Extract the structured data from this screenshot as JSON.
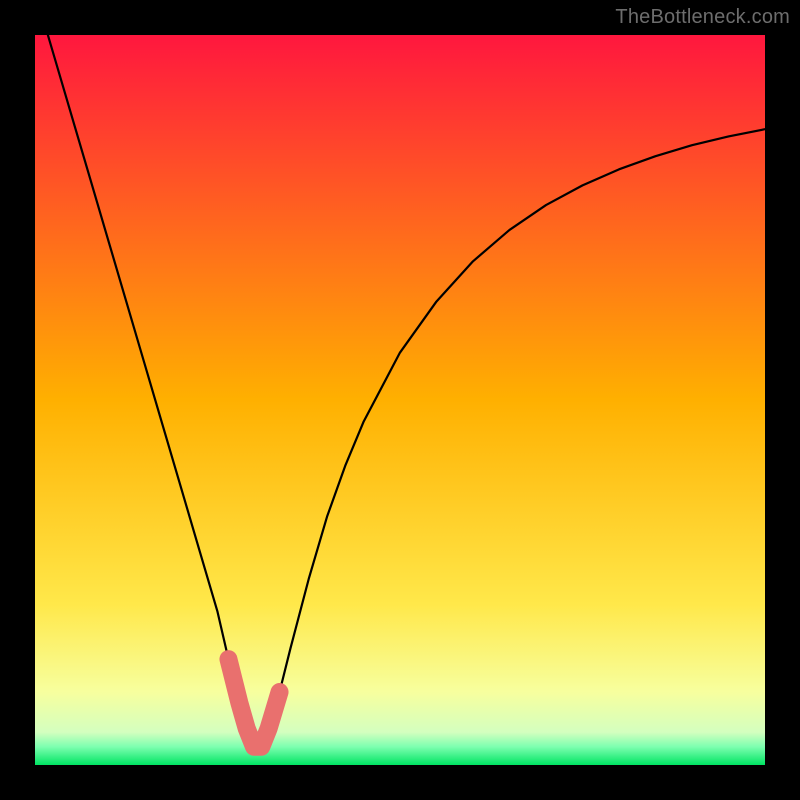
{
  "watermark": "TheBottleneck.com",
  "colors": {
    "frame": "#000000",
    "gradient_top": "#ff173e",
    "gradient_mid": "#ffd400",
    "gradient_green": "#00e463",
    "curve": "#000000",
    "highlight": "#e9706e"
  },
  "chart_data": {
    "type": "line",
    "title": "",
    "xlabel": "",
    "ylabel": "",
    "xlim": [
      0,
      100
    ],
    "ylim": [
      0,
      100
    ],
    "grid": false,
    "series": [
      {
        "name": "bottleneck-curve",
        "x": [
          0.0,
          2.5,
          5.0,
          7.5,
          10.0,
          12.5,
          15.0,
          17.5,
          20.0,
          22.5,
          25.0,
          26.5,
          28.0,
          29.0,
          30.0,
          31.0,
          32.0,
          33.5,
          35.0,
          37.5,
          40.0,
          42.5,
          45.0,
          50.0,
          55.0,
          60.0,
          65.0,
          70.0,
          75.0,
          80.0,
          85.0,
          90.0,
          95.0,
          100.0
        ],
        "values": [
          106.0,
          97.5,
          89.0,
          80.5,
          72.0,
          63.5,
          55.0,
          46.5,
          38.0,
          29.5,
          21.0,
          14.5,
          8.5,
          5.0,
          2.5,
          2.5,
          5.0,
          10.0,
          16.0,
          25.5,
          34.0,
          41.0,
          47.0,
          56.5,
          63.5,
          69.0,
          73.3,
          76.7,
          79.4,
          81.6,
          83.4,
          84.9,
          86.1,
          87.1
        ]
      },
      {
        "name": "highlight-segment",
        "x": [
          26.5,
          27.25,
          28.0,
          28.5,
          29.0,
          29.5,
          30.0,
          30.5,
          31.0,
          31.5,
          32.0,
          32.75,
          33.5
        ],
        "values": [
          14.5,
          11.5,
          8.5,
          6.75,
          5.0,
          3.75,
          2.5,
          2.5,
          2.5,
          3.75,
          5.0,
          7.5,
          10.0
        ]
      }
    ],
    "gradient_stops": [
      {
        "pos": 0.0,
        "color": "#ff173e"
      },
      {
        "pos": 0.5,
        "color": "#ffb000"
      },
      {
        "pos": 0.78,
        "color": "#ffe84a"
      },
      {
        "pos": 0.9,
        "color": "#f7ff9e"
      },
      {
        "pos": 0.955,
        "color": "#d4ffbf"
      },
      {
        "pos": 0.975,
        "color": "#7dffb0"
      },
      {
        "pos": 1.0,
        "color": "#00e463"
      }
    ]
  }
}
